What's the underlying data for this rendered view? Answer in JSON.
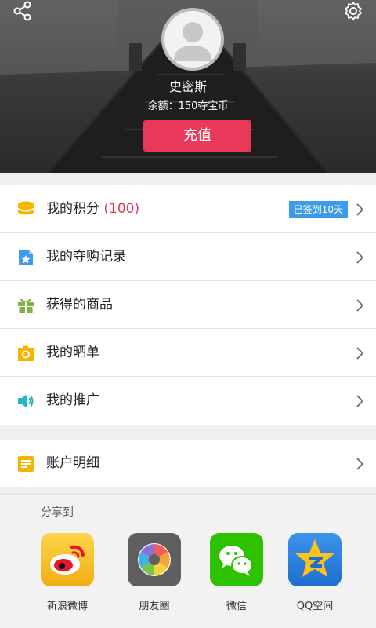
{
  "header": {
    "username": "史密斯",
    "balance": "余额：150夺宝币",
    "recharge_label": "充值"
  },
  "menu": [
    {
      "label": "我的积分",
      "count": "(100)",
      "badge": "已签到10天",
      "icon": "database-icon",
      "icon_color": "#f4b400"
    },
    {
      "label": "我的夺购记录",
      "icon": "bookmark-star-icon",
      "icon_color": "#3d9be9"
    },
    {
      "label": "获得的商品",
      "icon": "gift-icon",
      "icon_color": "#7cb342"
    },
    {
      "label": "我的晒单",
      "icon": "camera-icon",
      "icon_color": "#f4b400"
    },
    {
      "label": "我的推广",
      "icon": "speaker-icon",
      "icon_color": "#26b5c5"
    }
  ],
  "account": {
    "label": "账户明细",
    "icon": "notepad-icon",
    "icon_color": "#f4b400"
  },
  "share": {
    "title": "分享到",
    "options": [
      {
        "label": "新浪微博",
        "icon": "weibo-icon"
      },
      {
        "label": "朋友圈",
        "icon": "moments-icon"
      },
      {
        "label": "微信",
        "icon": "wechat-icon"
      },
      {
        "label": "QQ空间",
        "icon": "qzone-icon"
      }
    ]
  },
  "colors": {
    "accent": "#e8395a",
    "badge": "#3d9be9",
    "wechat": "#2dc100",
    "qzone": "#2b7fdb",
    "weibo": "#f9c31b"
  }
}
